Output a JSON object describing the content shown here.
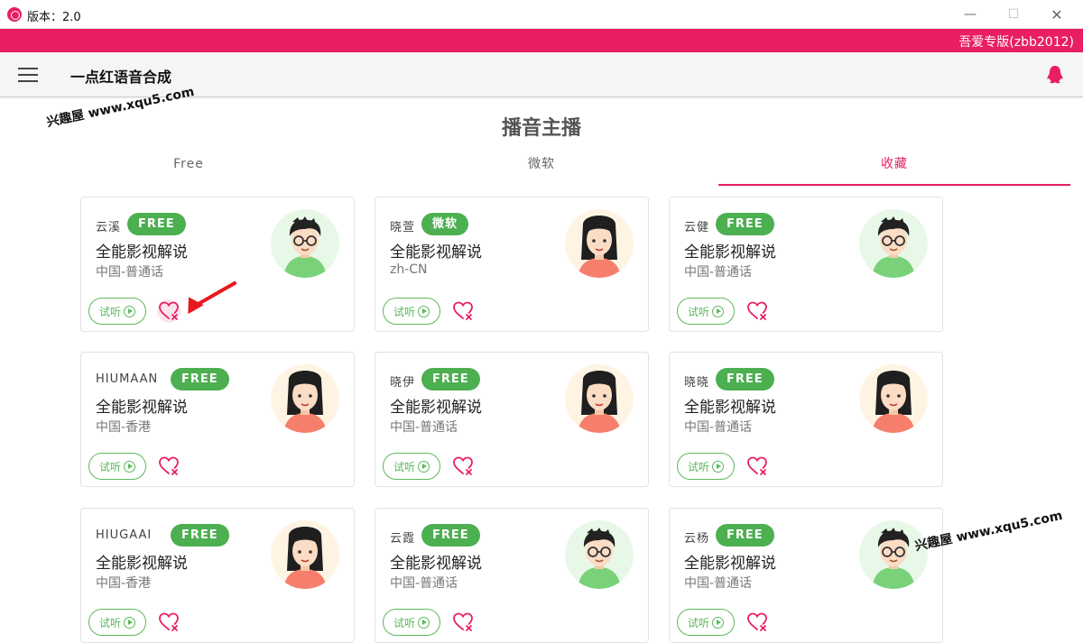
{
  "window": {
    "title": "版本：2.0",
    "minimize": "—",
    "maximize": "☐",
    "close": "✕"
  },
  "brand": {
    "text": "吾爱专版(zbb2012)"
  },
  "appbar": {
    "title": "一点红语音合成"
  },
  "page": {
    "title": "播音主播"
  },
  "tabs": [
    {
      "label": "Free",
      "active": false
    },
    {
      "label": "微软",
      "active": false
    },
    {
      "label": "收藏",
      "active": true
    }
  ],
  "colors": {
    "accent": "#e91e63",
    "badge": "#4caf50",
    "listen": "#5cb85c"
  },
  "cards": [
    {
      "name": "云溪",
      "badge": "FREE",
      "title": "全能影视解说",
      "locale": "中国-普通话",
      "avatar": "male-avatar",
      "listen": "试听",
      "highlight": true
    },
    {
      "name": "晓萱",
      "badge": "微软",
      "title": "全能影视解说",
      "locale": "zh-CN",
      "avatar": "female-avatar",
      "listen": "试听",
      "highlight": false
    },
    {
      "name": "云健",
      "badge": "FREE",
      "title": "全能影视解说",
      "locale": "中国-普通话",
      "avatar": "male-avatar",
      "listen": "试听",
      "highlight": false
    },
    {
      "name": "HIUMAAN",
      "badge": "FREE",
      "title": "全能影视解说",
      "locale": "中国-香港",
      "avatar": "female-avatar",
      "listen": "试听",
      "highlight": false
    },
    {
      "name": "晓伊",
      "badge": "FREE",
      "title": "全能影视解说",
      "locale": "中国-普通话",
      "avatar": "female-avatar",
      "listen": "试听",
      "highlight": false
    },
    {
      "name": "晓晓",
      "badge": "FREE",
      "title": "全能影视解说",
      "locale": "中国-普通话",
      "avatar": "female-avatar",
      "listen": "试听",
      "highlight": false
    },
    {
      "name": "HIUGAAI",
      "badge": "FREE",
      "title": "全能影视解说",
      "locale": "中国-香港",
      "avatar": "female-avatar",
      "listen": "试听",
      "highlight": false
    },
    {
      "name": "云霞",
      "badge": "FREE",
      "title": "全能影视解说",
      "locale": "中国-普通话",
      "avatar": "male-avatar",
      "listen": "试听",
      "highlight": false
    },
    {
      "name": "云杨",
      "badge": "FREE",
      "title": "全能影视解说",
      "locale": "中国-普通话",
      "avatar": "male-avatar",
      "listen": "试听",
      "highlight": false
    }
  ],
  "watermarks": [
    "兴趣屋 www.xqu5.com",
    "兴趣屋 www.xqu5.com"
  ]
}
